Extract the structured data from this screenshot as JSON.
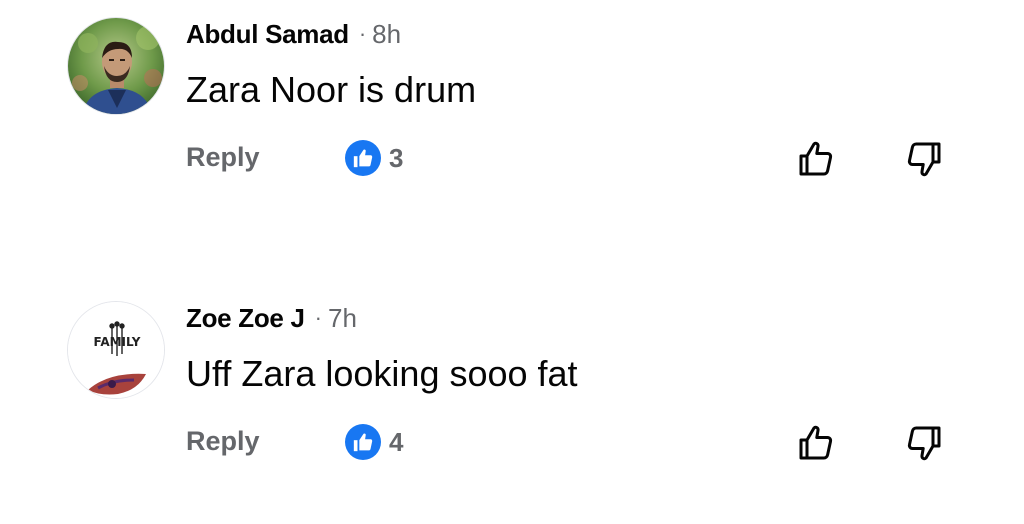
{
  "comments": [
    {
      "author": "Abdul Samad",
      "separator": "·",
      "time": "8h",
      "text": "Zara Noor is drum",
      "reply_label": "Reply",
      "reaction_icon": "like-icon",
      "reaction_count": "3",
      "avatar": "profile-photo"
    },
    {
      "author": "Zoe Zoe J",
      "separator": "·",
      "time": "7h",
      "text": "Uff Zara looking sooo fat",
      "reply_label": "Reply",
      "reaction_icon": "like-icon",
      "reaction_count": "4",
      "avatar": "family-logo",
      "avatar_logo_text": "FAMILY"
    }
  ],
  "colors": {
    "like_blue": "#1877f2",
    "secondary_text": "#65676b",
    "primary_text": "#050505"
  }
}
